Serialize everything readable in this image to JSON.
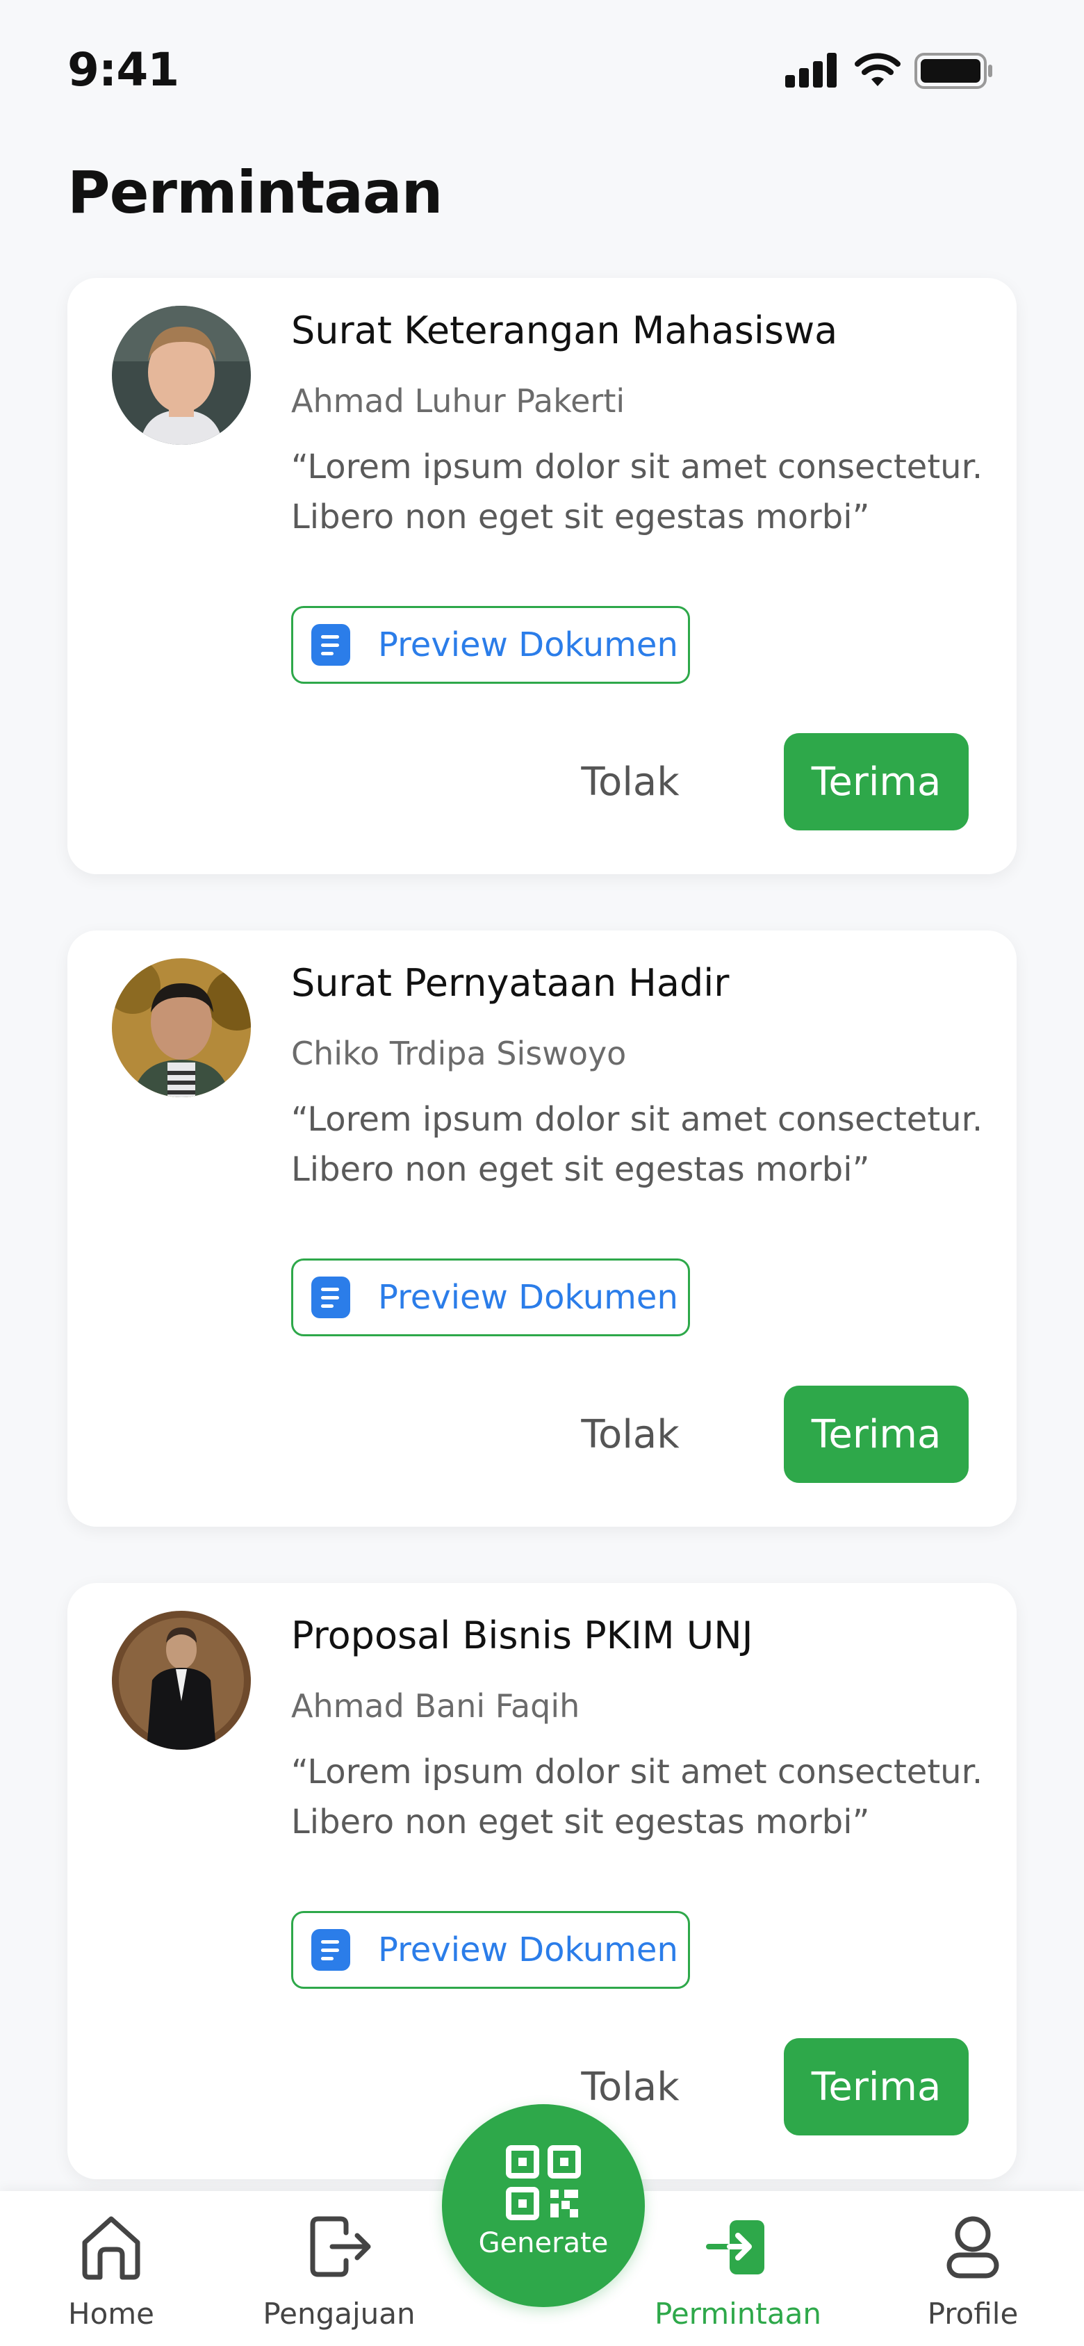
{
  "status_bar": {
    "time": "9:41"
  },
  "page": {
    "title": "Permintaan"
  },
  "requests": [
    {
      "title": "Surat Keterangan Mahasiswa",
      "name": "Ahmad Luhur Pakerti",
      "note": "“Lorem ipsum dolor sit amet consectetur. Libero non eget sit egestas morbi”",
      "preview_label": "Preview Dokumen",
      "reject_label": "Tolak",
      "accept_label": "Terima"
    },
    {
      "title": "Surat Pernyataan Hadir",
      "name": "Chiko Trdipa Siswoyo",
      "note": "“Lorem ipsum dolor sit amet consectetur. Libero non eget sit egestas morbi”",
      "preview_label": "Preview Dokumen",
      "reject_label": "Tolak",
      "accept_label": "Terima"
    },
    {
      "title": "Proposal Bisnis PKIM UNJ",
      "name": "Ahmad Bani Faqih",
      "note": "“Lorem ipsum dolor sit amet consectetur. Libero non eget sit egestas morbi”",
      "preview_label": "Preview Dokumen",
      "reject_label": "Tolak",
      "accept_label": "Terima"
    }
  ],
  "nav": {
    "items": [
      {
        "label": "Home",
        "icon": "home-icon"
      },
      {
        "label": "Pengajuan",
        "icon": "submission-icon"
      },
      {
        "label": "Permintaan",
        "icon": "request-icon",
        "active": true
      },
      {
        "label": "Profile",
        "icon": "profile-icon"
      }
    ],
    "fab": {
      "label": "Generate",
      "icon": "qr-code-icon"
    }
  },
  "colors": {
    "accent": "#2ea84a",
    "link": "#2b7de9",
    "background": "#f7f8fa"
  }
}
